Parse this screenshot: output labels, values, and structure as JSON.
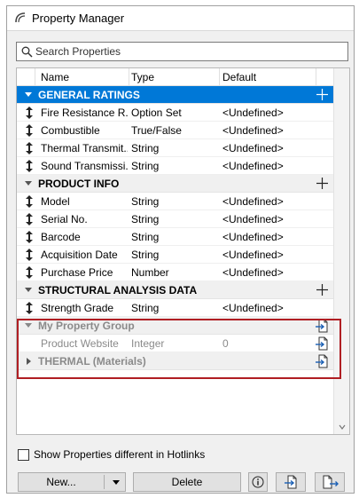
{
  "window": {
    "title": "Property Manager"
  },
  "search": {
    "placeholder": "Search Properties"
  },
  "columns": {
    "name": "Name",
    "type": "Type",
    "default": "Default"
  },
  "groups": {
    "general": {
      "title": "GENERAL RATINGS",
      "items": [
        {
          "name": "Fire Resistance R...",
          "type": "Option Set",
          "default": "<Undefined>"
        },
        {
          "name": "Combustible",
          "type": "True/False",
          "default": "<Undefined>"
        },
        {
          "name": "Thermal Transmit...",
          "type": "String",
          "default": "<Undefined>"
        },
        {
          "name": "Sound Transmissi...",
          "type": "String",
          "default": "<Undefined>"
        }
      ]
    },
    "product": {
      "title": "PRODUCT INFO",
      "items": [
        {
          "name": "Model",
          "type": "String",
          "default": "<Undefined>"
        },
        {
          "name": "Serial No.",
          "type": "String",
          "default": "<Undefined>"
        },
        {
          "name": "Barcode",
          "type": "String",
          "default": "<Undefined>"
        },
        {
          "name": "Acquisition Date",
          "type": "String",
          "default": "<Undefined>"
        },
        {
          "name": "Purchase Price",
          "type": "Number",
          "default": "<Undefined>"
        }
      ]
    },
    "structural": {
      "title": "STRUCTURAL ANALYSIS DATA",
      "items": [
        {
          "name": "Strength Grade",
          "type": "String",
          "default": "<Undefined>"
        }
      ]
    },
    "my_group": {
      "title": "My Property Group",
      "items": [
        {
          "name": "Product Website",
          "type": "Integer",
          "default": "0"
        }
      ]
    },
    "thermal": {
      "title": "THERMAL (Materials)"
    }
  },
  "show_diff": {
    "label": "Show Properties different in Hotlinks",
    "checked": false
  },
  "buttons": {
    "new": "New...",
    "delete": "Delete"
  },
  "colors": {
    "selection": "#0078d7",
    "highlight_border": "#b01e23",
    "dim_text": "#8a8a8a"
  }
}
